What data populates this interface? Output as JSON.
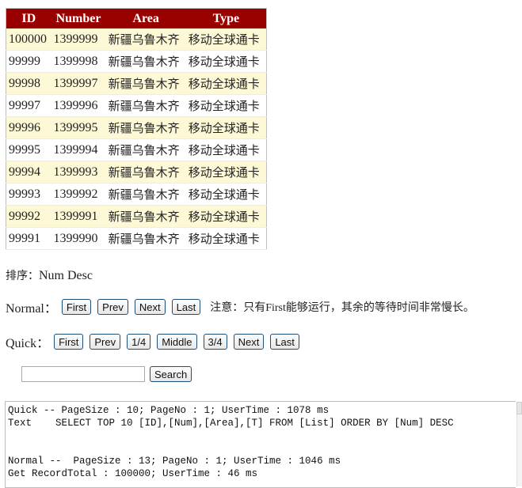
{
  "table": {
    "headers": [
      "ID",
      "Number",
      "Area",
      "Type"
    ],
    "rows": [
      [
        "100000",
        "1399999",
        "新疆乌鲁木齐",
        "移动全球通卡"
      ],
      [
        "99999",
        "1399998",
        "新疆乌鲁木齐",
        "移动全球通卡"
      ],
      [
        "99998",
        "1399997",
        "新疆乌鲁木齐",
        "移动全球通卡"
      ],
      [
        "99997",
        "1399996",
        "新疆乌鲁木齐",
        "移动全球通卡"
      ],
      [
        "99996",
        "1399995",
        "新疆乌鲁木齐",
        "移动全球通卡"
      ],
      [
        "99995",
        "1399994",
        "新疆乌鲁木齐",
        "移动全球通卡"
      ],
      [
        "99994",
        "1399993",
        "新疆乌鲁木齐",
        "移动全球通卡"
      ],
      [
        "99993",
        "1399992",
        "新疆乌鲁木齐",
        "移动全球通卡"
      ],
      [
        "99992",
        "1399991",
        "新疆乌鲁木齐",
        "移动全球通卡"
      ],
      [
        "99991",
        "1399990",
        "新疆乌鲁木齐",
        "移动全球通卡"
      ]
    ],
    "colors": {
      "header_bg": "#990000",
      "odd_row_bg": "#fdf9d7",
      "even_row_bg": "#ffffff"
    }
  },
  "sort": {
    "label": "排序：",
    "value": "Num Desc"
  },
  "normal": {
    "label": "Normal：",
    "buttons": [
      "First",
      "Prev",
      "Next",
      "Last"
    ],
    "note_prefix": "注意：只有",
    "note_en": "First",
    "note_suffix": "能够运行，其余的等待时间非常慢长。"
  },
  "quick": {
    "label": "Quick：",
    "buttons": [
      "First",
      "Prev",
      "1/4",
      "Middle",
      "3/4",
      "Next",
      "Last"
    ]
  },
  "search": {
    "value": "",
    "button_label": "Search"
  },
  "log": {
    "lines": [
      "Quick -- PageSize : 10; PageNo : 1; UserTime : 1078 ms",
      "Text    SELECT TOP 10 [ID],[Num],[Area],[T] FROM [List] ORDER BY [Num] DESC",
      "",
      "",
      "Normal --  PageSize : 13; PageNo : 1; UserTime : 1046 ms",
      "Get RecordTotal : 100000; UserTime : 46 ms"
    ]
  }
}
